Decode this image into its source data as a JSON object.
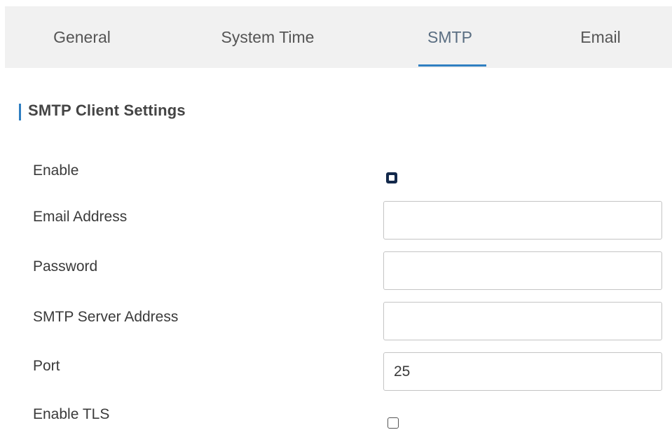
{
  "tabs": {
    "general": "General",
    "system_time": "System Time",
    "smtp": "SMTP",
    "email": "Email",
    "active": "SMTP"
  },
  "section": {
    "title": "SMTP Client Settings"
  },
  "form": {
    "enable_label": "Enable",
    "enable_checked": true,
    "email_address_label": "Email Address",
    "email_address_value": "",
    "password_label": "Password",
    "password_value": "",
    "server_address_label": "SMTP Server Address",
    "server_address_value": "",
    "port_label": "Port",
    "port_value": "25",
    "enable_tls_label": "Enable TLS",
    "enable_tls_checked": false
  },
  "colors": {
    "accent": "#2f7fc1",
    "tab_bar_bg": "#f1f1f1",
    "checkbox_checked": "#13294b"
  }
}
